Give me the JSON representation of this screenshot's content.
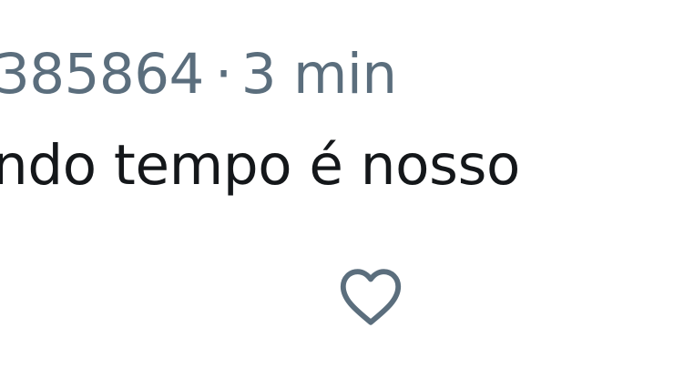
{
  "tweet": {
    "handle_fragment": "385864",
    "separator": "·",
    "timestamp": "3 min",
    "text": "ndo tempo é nosso"
  },
  "actions": {
    "like_icon": "heart-outline-icon"
  },
  "colors": {
    "meta_text": "#5b6e7d",
    "body_text": "#14171a",
    "icon": "#5b6e7d",
    "background": "#ffffff"
  }
}
